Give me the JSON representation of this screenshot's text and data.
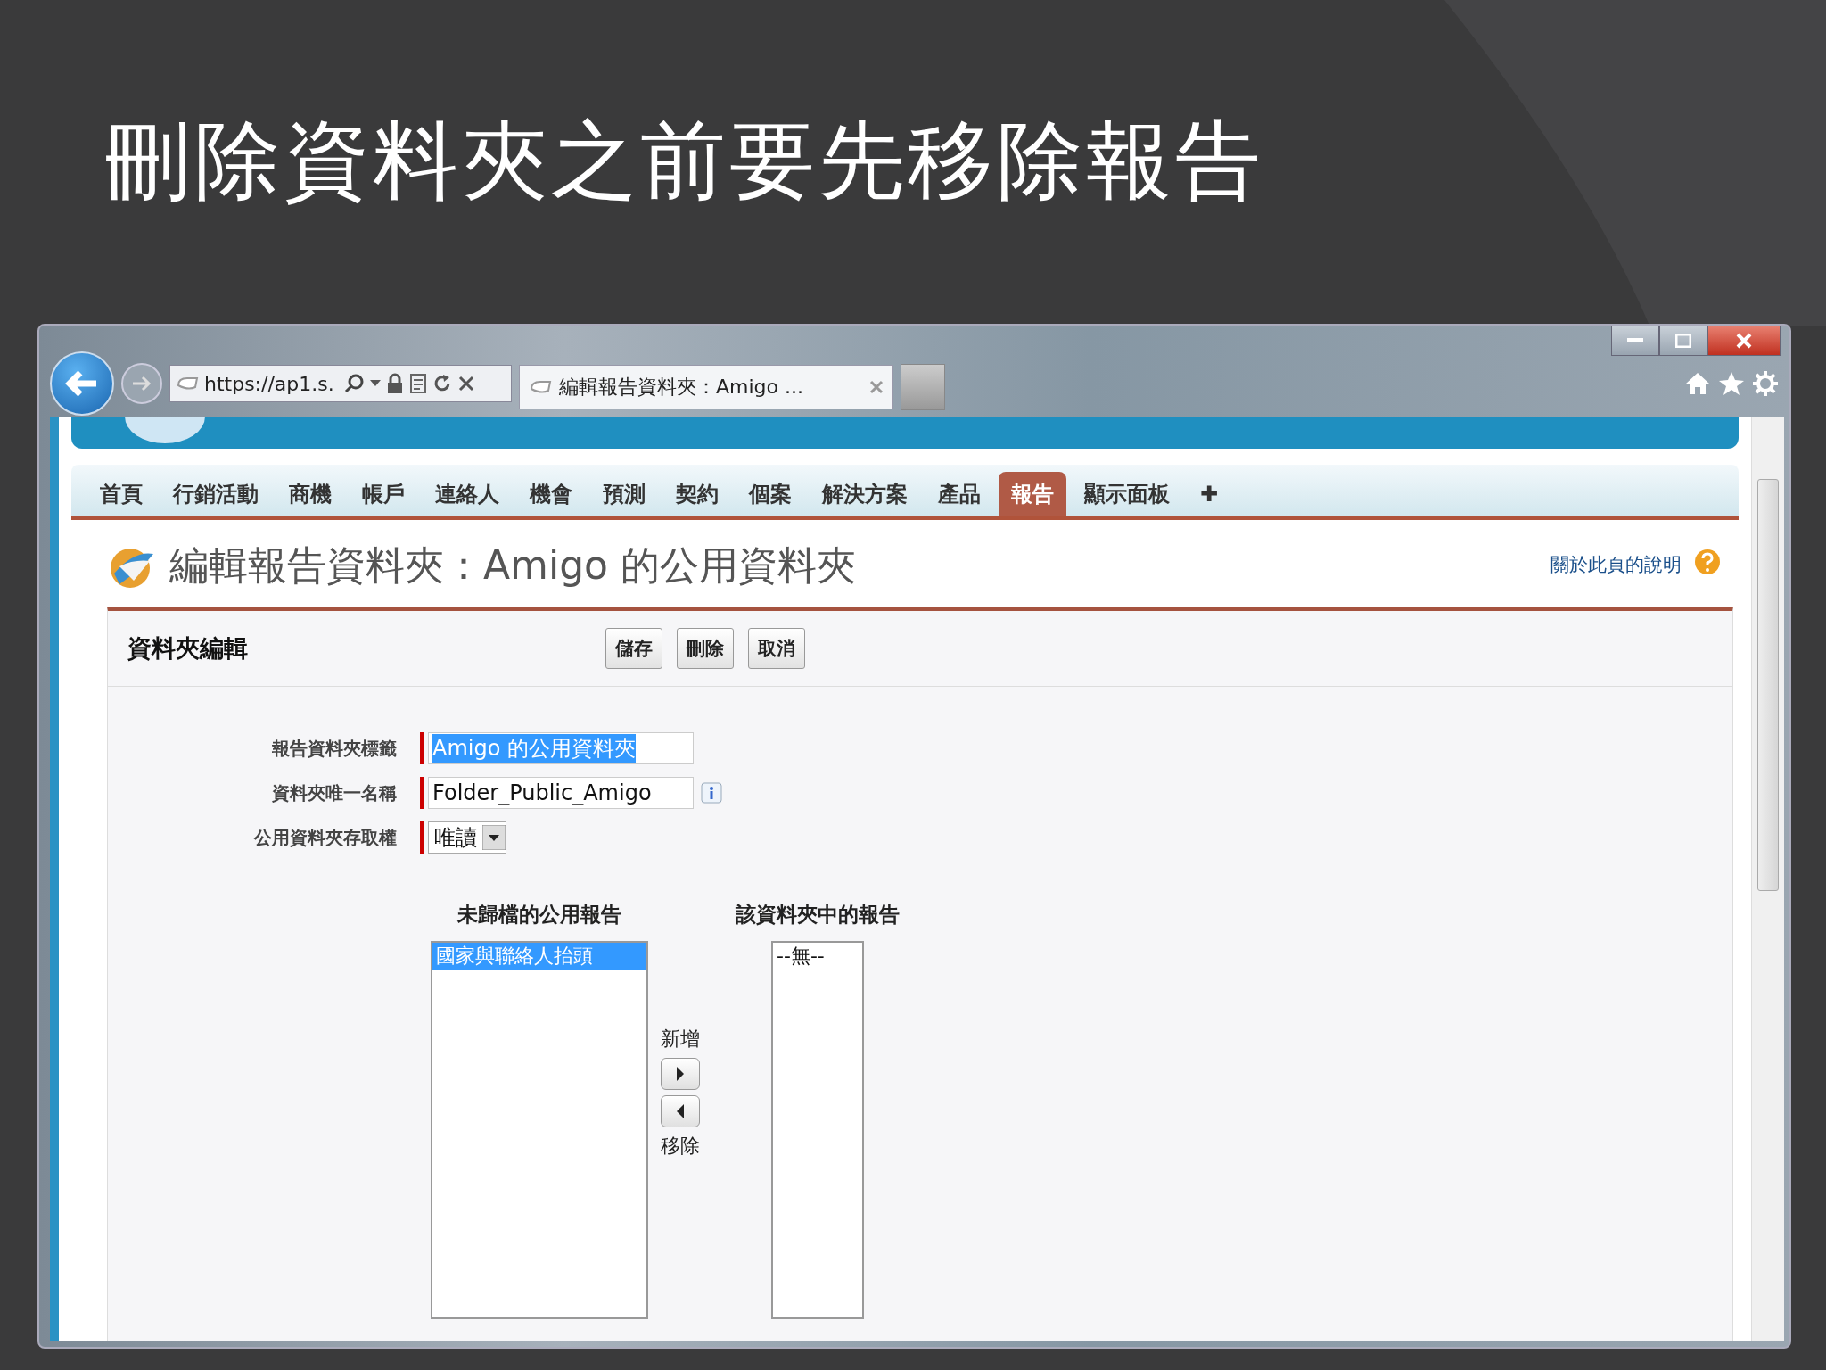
{
  "slide": {
    "title": "刪除資料夾之前要先移除報告"
  },
  "browser": {
    "address": "https://ap1.s.",
    "tabs": [
      {
        "label": "編輯報告資料夾：Amigo ...",
        "selected": true
      }
    ]
  },
  "nav_tabs": [
    {
      "label": "首頁",
      "selected": false
    },
    {
      "label": "行銷活動",
      "selected": false
    },
    {
      "label": "商機",
      "selected": false
    },
    {
      "label": "帳戶",
      "selected": false
    },
    {
      "label": "連絡人",
      "selected": false
    },
    {
      "label": "機會",
      "selected": false
    },
    {
      "label": "預測",
      "selected": false
    },
    {
      "label": "契約",
      "selected": false
    },
    {
      "label": "個案",
      "selected": false
    },
    {
      "label": "解決方案",
      "selected": false
    },
    {
      "label": "產品",
      "selected": false
    },
    {
      "label": "報告",
      "selected": true
    },
    {
      "label": "顯示面板",
      "selected": false
    },
    {
      "label": "✚",
      "selected": false
    }
  ],
  "page": {
    "title": "編輯報告資料夾：Amigo 的公用資料夾",
    "help_link": "關於此頁的說明"
  },
  "section": {
    "title": "資料夾編輯",
    "buttons": [
      "儲存",
      "刪除",
      "取消"
    ]
  },
  "form": {
    "fields": [
      {
        "label": "報告資料夾標籤",
        "value": "Amigo 的公用資料夾",
        "kind": "text",
        "selected": true,
        "info": false
      },
      {
        "label": "資料夾唯一名稱",
        "value": "Folder_Public_Amigo",
        "kind": "text",
        "selected": false,
        "info": true
      },
      {
        "label": "公用資料夾存取權",
        "value": "唯讀",
        "kind": "select",
        "selected": false,
        "info": false
      }
    ]
  },
  "lists": {
    "available": {
      "heading": "未歸檔的公用報告",
      "items": [
        {
          "label": "國家與聯絡人抬頭",
          "selected": true
        }
      ]
    },
    "add_label": "新增",
    "remove_label": "移除",
    "in_folder": {
      "heading": "該資料夾中的報告",
      "items": [
        {
          "label": "--無--",
          "selected": false
        }
      ]
    }
  }
}
